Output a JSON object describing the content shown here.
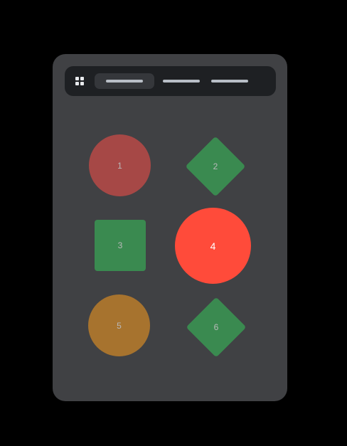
{
  "navbar": {
    "menu_icon": "grid-icon",
    "tabs": [
      {
        "label": "",
        "active": true
      },
      {
        "label": "",
        "active": false
      },
      {
        "label": "",
        "active": false
      }
    ]
  },
  "shapes": [
    {
      "label": "1",
      "kind": "circle",
      "color": "#a64846"
    },
    {
      "label": "2",
      "kind": "diamond",
      "color": "#3a8a50"
    },
    {
      "label": "3",
      "kind": "square",
      "color": "#3a8a50"
    },
    {
      "label": "4",
      "kind": "circle",
      "color": "#ff4b3a"
    },
    {
      "label": "5",
      "kind": "circle",
      "color": "#a7732e"
    },
    {
      "label": "6",
      "kind": "diamond",
      "color": "#3a8a50"
    }
  ],
  "colors": {
    "background": "#000000",
    "card": "#404144",
    "navbar": "#1e2023",
    "label_muted": "#b9b9b9",
    "label_highlight": "#ffffff"
  }
}
